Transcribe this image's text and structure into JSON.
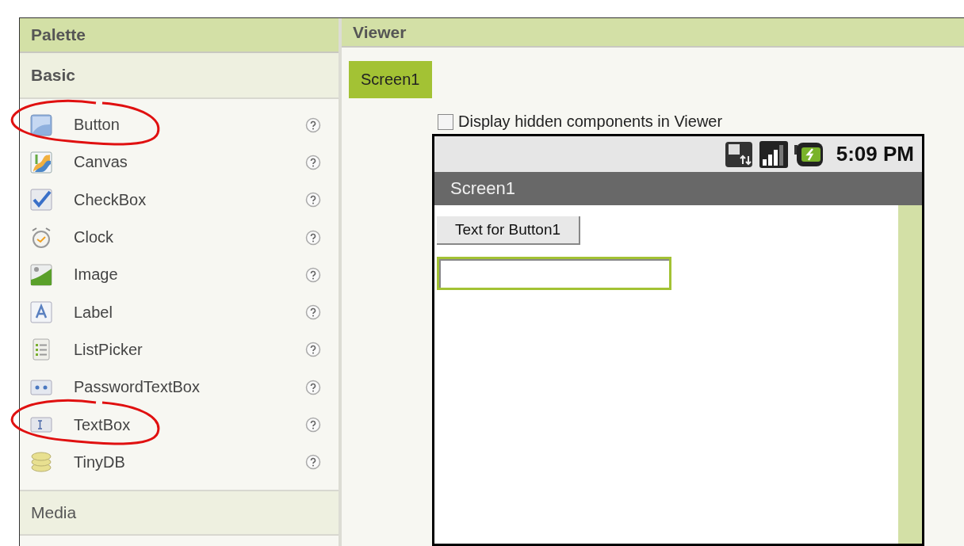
{
  "palette": {
    "title": "Palette",
    "sections": [
      {
        "title": "Basic",
        "items": [
          {
            "label": "Button",
            "kind": "button",
            "circled": true
          },
          {
            "label": "Canvas",
            "kind": "canvas",
            "circled": false
          },
          {
            "label": "CheckBox",
            "kind": "checkbox",
            "circled": false
          },
          {
            "label": "Clock",
            "kind": "clock",
            "circled": false
          },
          {
            "label": "Image",
            "kind": "image",
            "circled": false
          },
          {
            "label": "Label",
            "kind": "label",
            "circled": false
          },
          {
            "label": "ListPicker",
            "kind": "listpicker",
            "circled": false
          },
          {
            "label": "PasswordTextBox",
            "kind": "password",
            "circled": false
          },
          {
            "label": "TextBox",
            "kind": "textbox",
            "circled": true
          },
          {
            "label": "TinyDB",
            "kind": "tinydb",
            "circled": false
          }
        ]
      },
      {
        "title": "Media"
      }
    ]
  },
  "viewer": {
    "title": "Viewer",
    "tabs": [
      {
        "label": "Screen1",
        "selected": true
      }
    ],
    "hidden_toggle": {
      "label": "Display hidden components in Viewer",
      "checked": false
    },
    "phone": {
      "time": "5:09 PM",
      "title": "Screen1",
      "button": "Text for Button1",
      "textbox": {
        "focused": true
      }
    }
  }
}
